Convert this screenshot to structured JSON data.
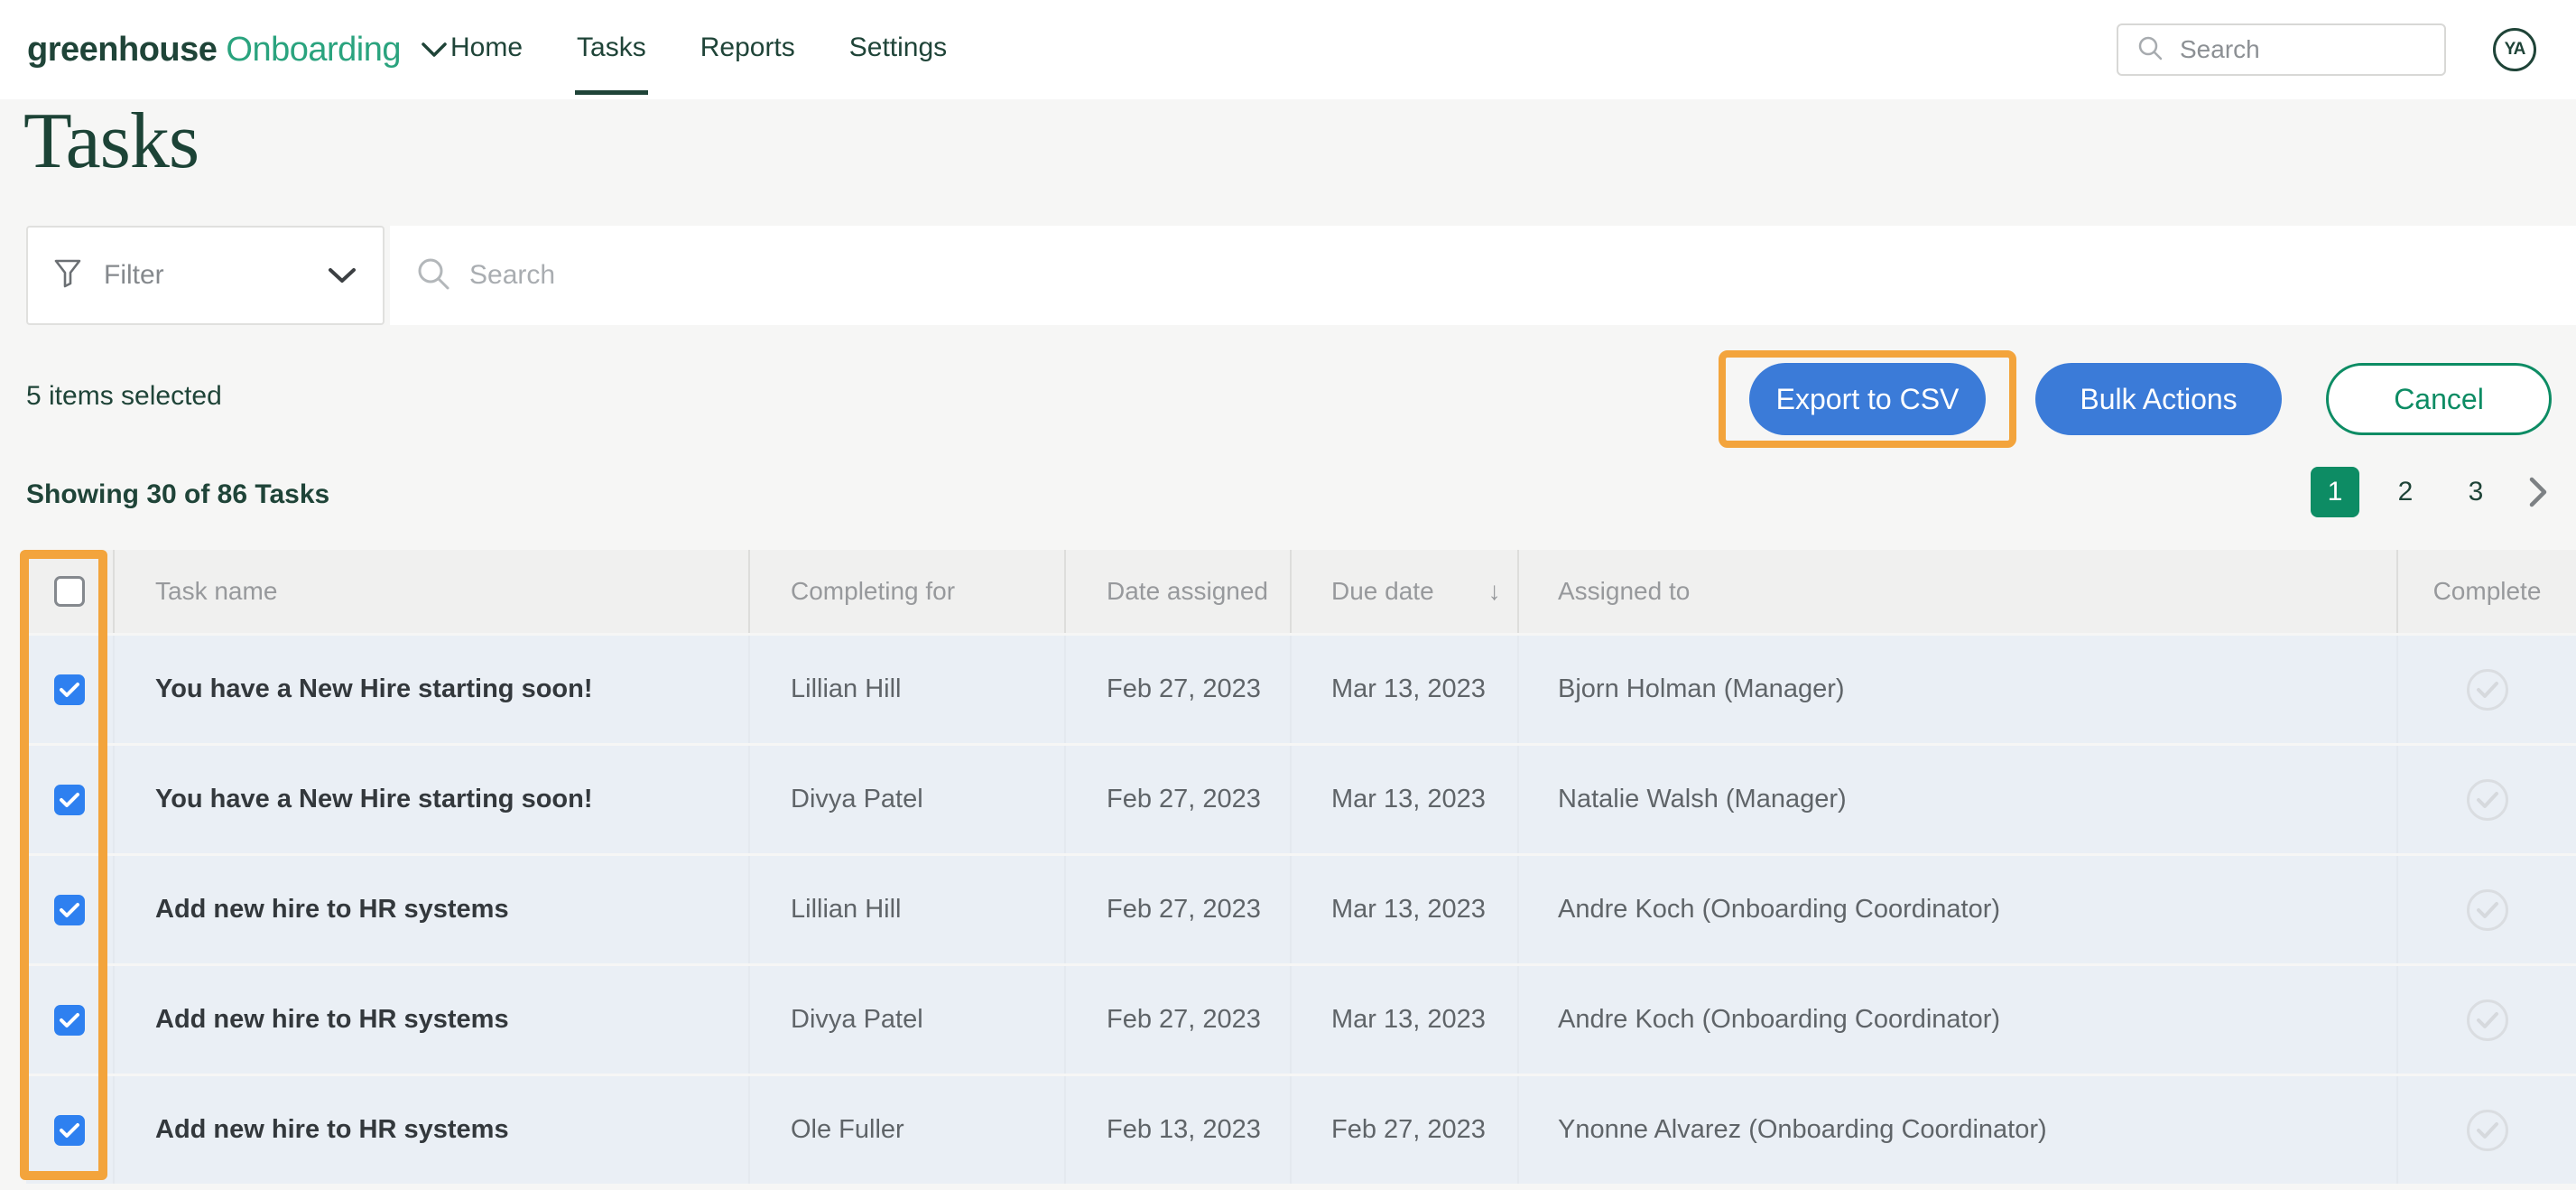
{
  "header": {
    "logo_primary": "greenhouse",
    "logo_secondary": "Onboarding",
    "nav": [
      {
        "label": "Home",
        "active": false
      },
      {
        "label": "Tasks",
        "active": true
      },
      {
        "label": "Reports",
        "active": false
      },
      {
        "label": "Settings",
        "active": false
      }
    ],
    "search_placeholder": "Search",
    "avatar_initials": "YA"
  },
  "page": {
    "title": "Tasks",
    "filter_label": "Filter",
    "search_placeholder": "Search",
    "selected_count_text": "5 items selected",
    "buttons": {
      "export": "Export to CSV",
      "bulk": "Bulk Actions",
      "cancel": "Cancel"
    },
    "showing_text": "Showing 30 of 86 Tasks",
    "pagination": {
      "pages": [
        "1",
        "2",
        "3"
      ],
      "active_page": "1"
    }
  },
  "table": {
    "columns": {
      "task_name": "Task name",
      "completing_for": "Completing for",
      "date_assigned": "Date assigned",
      "due_date": "Due date",
      "assigned_to": "Assigned to",
      "complete": "Complete"
    },
    "sort": {
      "column": "Due date",
      "direction": "desc",
      "arrow": "↓"
    },
    "rows": [
      {
        "selected": true,
        "task_name": "You have a New Hire starting soon!",
        "completing_for": "Lillian Hill",
        "date_assigned": "Feb 27, 2023",
        "due_date": "Mar 13, 2023",
        "assigned_to": "Bjorn Holman (Manager)"
      },
      {
        "selected": true,
        "task_name": "You have a New Hire starting soon!",
        "completing_for": "Divya Patel",
        "date_assigned": "Feb 27, 2023",
        "due_date": "Mar 13, 2023",
        "assigned_to": "Natalie Walsh (Manager)"
      },
      {
        "selected": true,
        "task_name": "Add new hire to HR systems",
        "completing_for": "Lillian Hill",
        "date_assigned": "Feb 27, 2023",
        "due_date": "Mar 13, 2023",
        "assigned_to": "Andre Koch (Onboarding Coordinator)"
      },
      {
        "selected": true,
        "task_name": "Add new hire to HR systems",
        "completing_for": "Divya Patel",
        "date_assigned": "Feb 27, 2023",
        "due_date": "Mar 13, 2023",
        "assigned_to": "Andre Koch (Onboarding Coordinator)"
      },
      {
        "selected": true,
        "task_name": "Add new hire to HR systems",
        "completing_for": "Ole Fuller",
        "date_assigned": "Feb 13, 2023",
        "due_date": "Feb 27, 2023",
        "assigned_to": "Ynonne Alvarez (Onboarding Coordinator)"
      }
    ]
  },
  "colors": {
    "brand_dark_green": "#1f4438",
    "brand_teal": "#2aa37e",
    "primary_blue": "#3b7bd8",
    "checkbox_blue": "#2e80f0",
    "highlight_orange": "#f3a43c",
    "active_green": "#0d8c64",
    "row_background": "#eaeff5",
    "header_background": "#f0f0ef"
  }
}
